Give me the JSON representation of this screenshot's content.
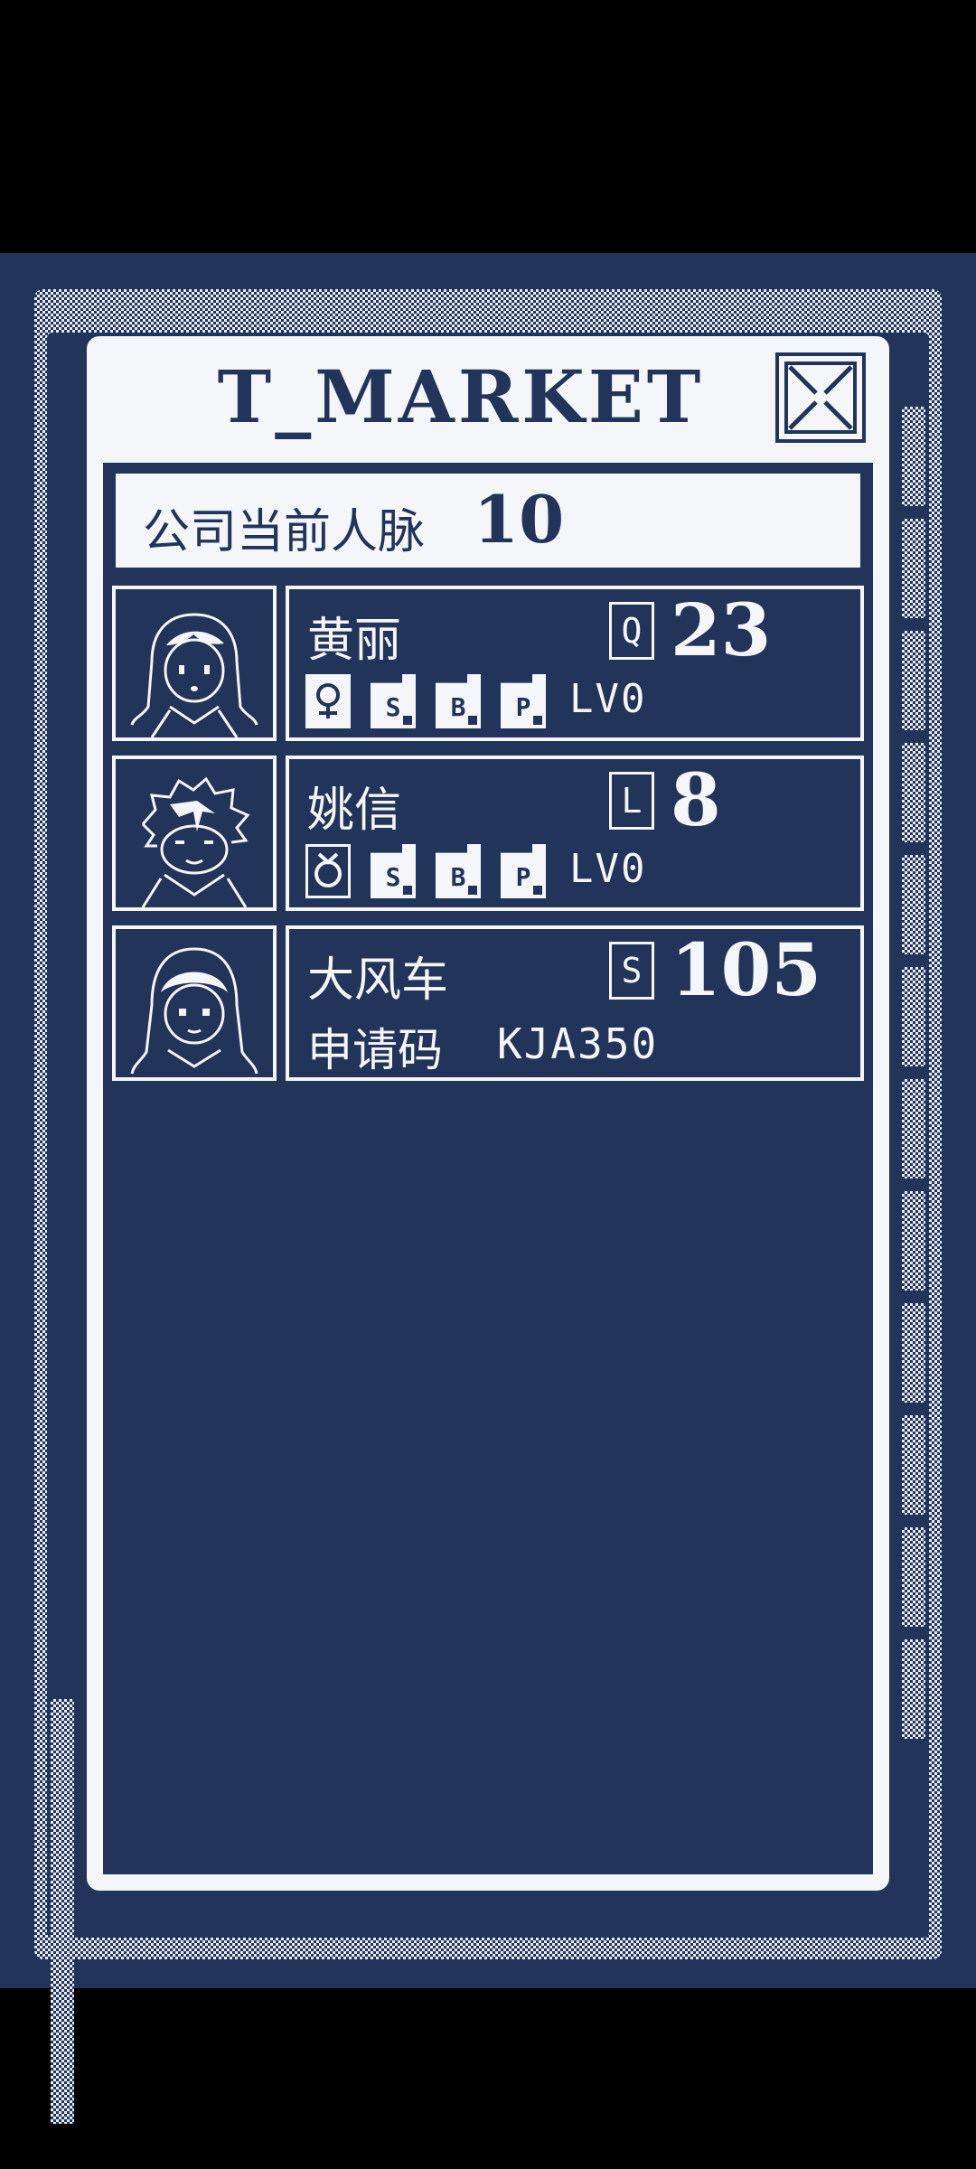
{
  "app": {
    "title": "T_MARKET"
  },
  "company": {
    "label": "公司当前人脉",
    "value": "10"
  },
  "contacts": [
    {
      "name": "黄丽",
      "rank": "Q",
      "value": "23",
      "gender_icon": "female-icon",
      "stats": [
        {
          "letter": "S",
          "icon": "stat-s-card-icon"
        },
        {
          "letter": "B",
          "icon": "stat-b-card-icon"
        },
        {
          "letter": "P",
          "icon": "stat-p-card-icon"
        }
      ],
      "level": "LV0"
    },
    {
      "name": "姚信",
      "rank": "L",
      "value": "8",
      "gender_icon": "male-icon",
      "stats": [
        {
          "letter": "S",
          "icon": "stat-s-card-icon"
        },
        {
          "letter": "B",
          "icon": "stat-b-card-icon"
        },
        {
          "letter": "P",
          "icon": "stat-p-card-icon"
        }
      ],
      "level": "LV0"
    },
    {
      "name": "大风车",
      "rank": "S",
      "value": "105",
      "code_label": "申请码",
      "code": "KJA350"
    }
  ],
  "colors": {
    "navy": "#22345a",
    "paper": "#f4f6f9",
    "black": "#000000"
  },
  "icons": {
    "close": "close-x-icon"
  }
}
